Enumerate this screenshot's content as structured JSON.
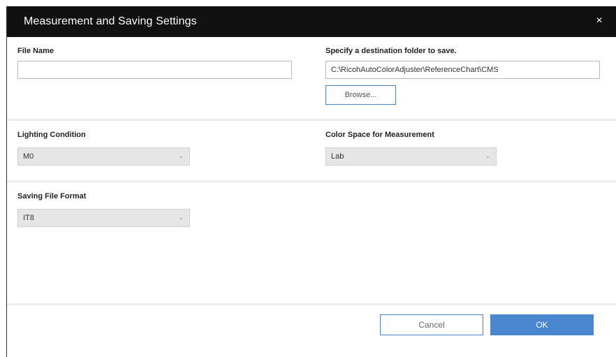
{
  "dialog": {
    "title": "Measurement and Saving Settings",
    "close_glyph": "×",
    "close_icon": "close-icon"
  },
  "file_name": {
    "label": "File Name",
    "value": ""
  },
  "destination": {
    "label": "Specify a destination folder to save.",
    "path": "C:\\RicohAutoColorAdjuster\\ReferenceChart\\CMS",
    "browse_label": "Browse..."
  },
  "lighting": {
    "label": "Lighting Condition",
    "selected": "M0",
    "chevron": "⌄",
    "chevron_icon": "chevron-down-icon"
  },
  "color_space": {
    "label": "Color Space for Measurement",
    "selected": "Lab",
    "chevron": "⌄",
    "chevron_icon": "chevron-down-icon"
  },
  "file_format": {
    "label": "Saving File Format",
    "selected": "IT8",
    "chevron": "⌄",
    "chevron_icon": "chevron-down-icon"
  },
  "footer": {
    "cancel_label": "Cancel",
    "ok_label": "OK"
  },
  "colors": {
    "titlebar": "#111111",
    "accent": "#4a86cf",
    "select_bg": "#e6e6e6"
  }
}
